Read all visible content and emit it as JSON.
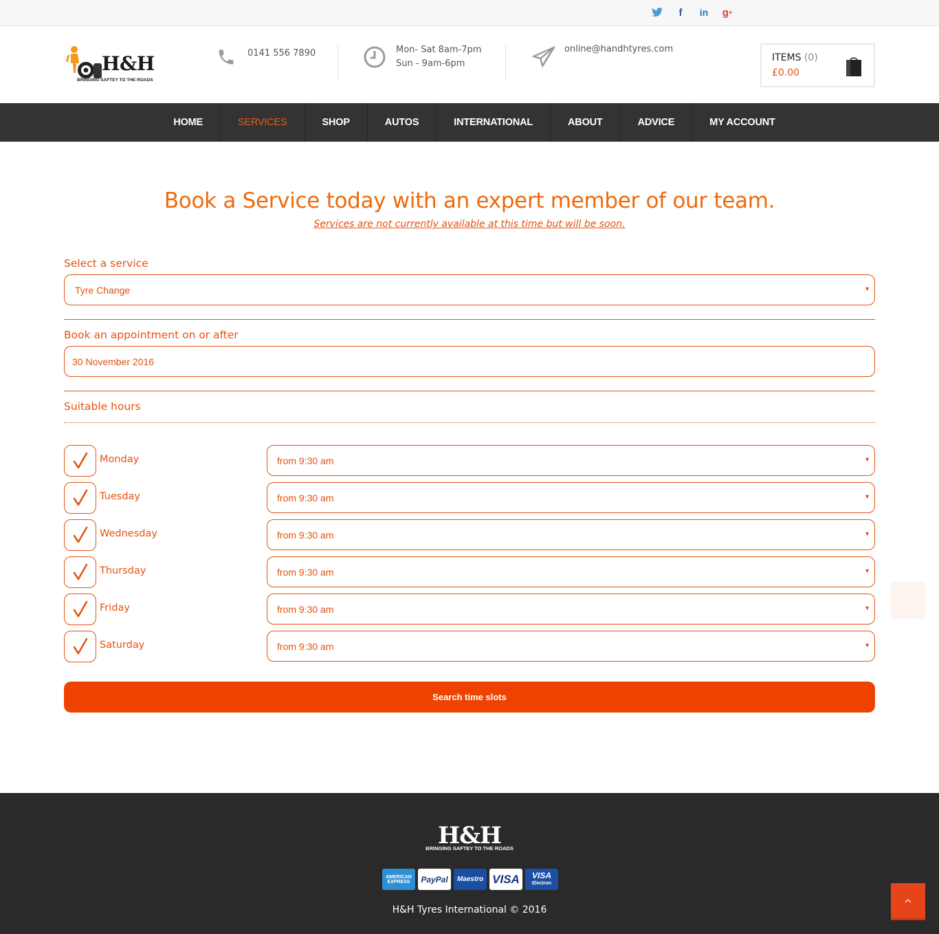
{
  "social": {
    "twitter": "twitter-icon",
    "facebook": "facebook-icon",
    "linkedin": "linkedin-icon",
    "googleplus": "google-plus-icon"
  },
  "header": {
    "brand": "H&H",
    "tagline": "BRINGING SAFTEY TO THE ROADS",
    "phone": "0141 556 7890",
    "hours_line1": "Mon- Sat 8am-7pm",
    "hours_line2": "Sun - 9am-6pm",
    "email": "online@handhtyres.com",
    "cart_label": "ITEMS",
    "cart_count": "(0)",
    "cart_total": "£0.00"
  },
  "nav": {
    "items": [
      "HOME",
      "SERVICES",
      "SHOP",
      "AUTOS",
      "INTERNATIONAL",
      "ABOUT",
      "ADVICE",
      "MY ACCOUNT"
    ],
    "active": "SERVICES"
  },
  "main": {
    "title": "Book a Service today with an expert member of our team.",
    "notice": "Services are not currently available at this time but will be soon.",
    "service_label": "Select a service",
    "service_value": "Tyre Change",
    "date_label": "Book an appointment on or after",
    "date_value": "30 November 2016",
    "hours_label": "Suitable hours",
    "days": [
      {
        "name": "Monday",
        "from": "from 9:30 am",
        "checked": true
      },
      {
        "name": "Tuesday",
        "from": "from 9:30 am",
        "checked": true
      },
      {
        "name": "Wednesday",
        "from": "from 9:30 am",
        "checked": true
      },
      {
        "name": "Thursday",
        "from": "from 9:30 am",
        "checked": true
      },
      {
        "name": "Friday",
        "from": "from 9:30 am",
        "checked": true
      },
      {
        "name": "Saturday",
        "from": "from 9:30 am",
        "checked": true
      }
    ],
    "search_button": "Search time slots"
  },
  "footer": {
    "brand": "H&H",
    "tagline": "BRINGING SAFTEY TO THE ROADS",
    "cards": {
      "amex_line1": "AMERICAN",
      "amex_line2": "EXPRESS",
      "paypal": "PayPal",
      "maestro": "Maestro",
      "visa": "VISA",
      "visa_electron": "VISA",
      "visa_electron_sub": "Electron"
    },
    "copyright": "H&H Tyres International © 2016"
  },
  "colors": {
    "accent": "#e2520f",
    "button": "#ef4200",
    "nav_bg": "#333333",
    "footer_bg": "#2a2a2a"
  }
}
